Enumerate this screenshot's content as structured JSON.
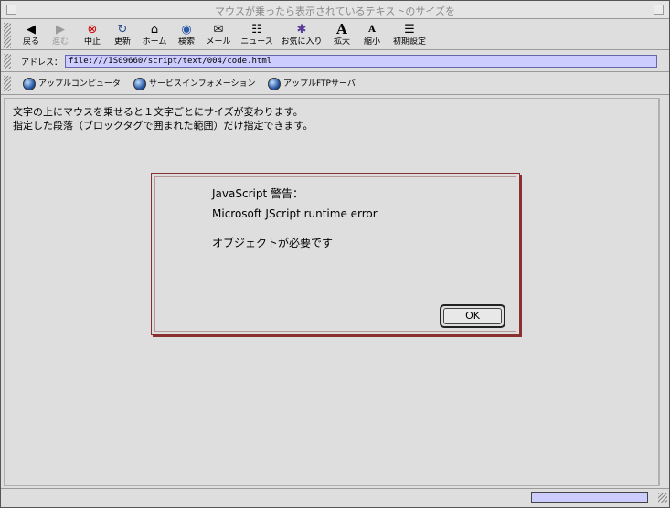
{
  "window": {
    "title": "マウスが乗ったら表示されているテキストのサイズを"
  },
  "toolbar": {
    "buttons": [
      {
        "label": "戻る",
        "icon": "back-arrow-icon"
      },
      {
        "label": "進む",
        "icon": "forward-arrow-icon",
        "disabled": true
      },
      {
        "label": "中止",
        "icon": "stop-icon"
      },
      {
        "label": "更新",
        "icon": "refresh-icon"
      },
      {
        "label": "ホーム",
        "icon": "home-icon"
      },
      {
        "label": "検索",
        "icon": "search-globe-icon"
      },
      {
        "label": "メール",
        "icon": "mail-icon"
      },
      {
        "label": "ニュース",
        "icon": "news-icon"
      },
      {
        "label": "お気に入り",
        "icon": "favorites-icon"
      },
      {
        "label": "拡大",
        "icon": "zoom-in-icon"
      },
      {
        "label": "縮小",
        "icon": "zoom-out-icon"
      },
      {
        "label": "初期設定",
        "icon": "preferences-icon"
      }
    ]
  },
  "address": {
    "label": "アドレス：",
    "url": "file:///IS09660/script/text/004/code.html"
  },
  "links": [
    {
      "label": "アップルコンピュータ"
    },
    {
      "label": "サービスインフォメーション"
    },
    {
      "label": "アップルFTPサーバ"
    }
  ],
  "content": {
    "line1": "文字の上にマウスを乗せると１文字ごとにサイズが変わります。",
    "line2": "指定した段落（ブロックタグで囲まれた範囲）だけ指定できます。"
  },
  "dialog": {
    "heading": "JavaScript 警告：",
    "error": "Microsoft JScript runtime error",
    "message": "オブジェクトが必要です",
    "ok_label": "OK"
  },
  "status": {
    "text": "",
    "progress_fraction": 0
  }
}
